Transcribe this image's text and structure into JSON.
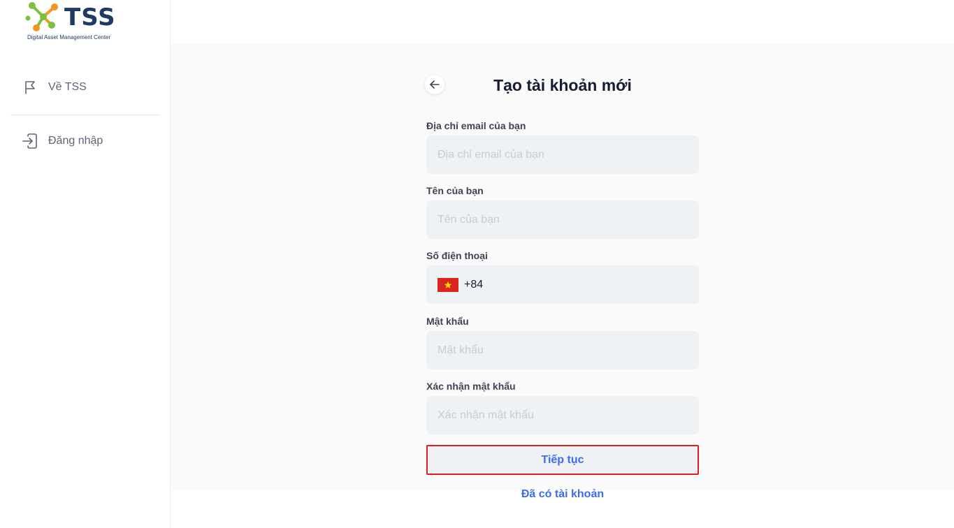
{
  "logo": {
    "name": "TSS",
    "tagline": "Digital Asset Management Center"
  },
  "sidebar": {
    "items": [
      {
        "label": "Về TSS",
        "icon": "flag-icon"
      },
      {
        "label": "Đăng nhập",
        "icon": "login-icon"
      }
    ]
  },
  "form": {
    "title": "Tạo tài khoản mới",
    "email": {
      "label": "Địa chỉ email của bạn",
      "placeholder": "Địa chỉ email của bạn",
      "value": ""
    },
    "name": {
      "label": "Tên của bạn",
      "placeholder": "Tên của bạn",
      "value": ""
    },
    "phone": {
      "label": "Số điện thoại",
      "country_code": "+84",
      "flag": "vietnam-flag-icon",
      "value": ""
    },
    "password": {
      "label": "Mật khẩu",
      "placeholder": "Mật khẩu",
      "value": ""
    },
    "confirm_password": {
      "label": "Xác nhận mật khẩu",
      "placeholder": "Xác nhận mật khẩu",
      "value": ""
    },
    "continue_label": "Tiếp tục",
    "have_account_label": "Đã có tài khoản"
  },
  "colors": {
    "brand_navy": "#1f3a63",
    "brand_green": "#7ac142",
    "brand_orange": "#f7941d",
    "link_blue": "#3b6cf6",
    "highlight_red": "#e31b23",
    "input_bg": "#eff2f5"
  }
}
